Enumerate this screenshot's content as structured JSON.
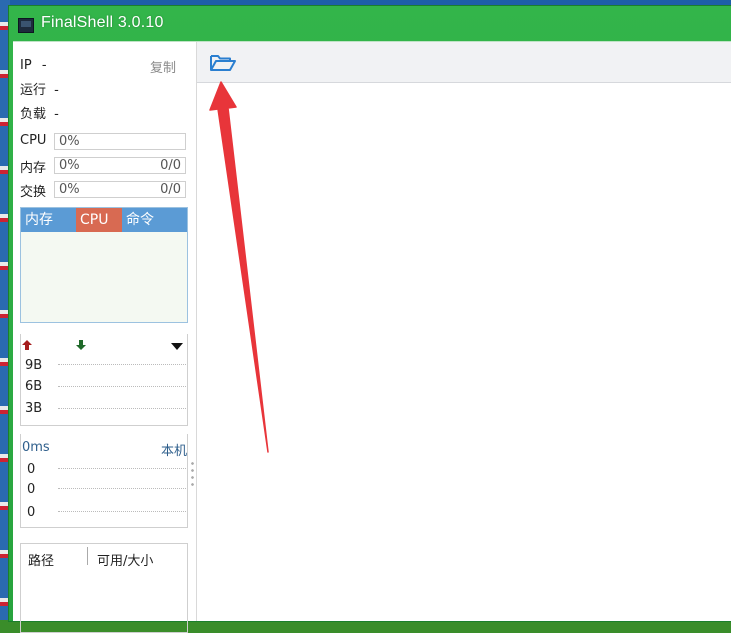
{
  "window": {
    "title": "FinalShell 3.0.10"
  },
  "sysinfo": {
    "ip_label": "IP",
    "ip_value": "-",
    "copy_label": "复制",
    "uptime_label": "运行",
    "uptime_value": "-",
    "load_label": "负载",
    "load_value": "-"
  },
  "meters": {
    "cpu": {
      "label": "CPU",
      "percent": "0%"
    },
    "memory": {
      "label": "内存",
      "percent": "0%",
      "ratio": "0/0"
    },
    "swap": {
      "label": "交换",
      "percent": "0%",
      "ratio": "0/0"
    }
  },
  "process_tabs": [
    "内存",
    "CPU",
    "命令"
  ],
  "network": {
    "up_icon": "arrow-up-icon",
    "down_icon": "arrow-down-icon",
    "y_ticks": [
      "9B",
      "6B",
      "3B"
    ]
  },
  "ping": {
    "latency": "0ms",
    "host": "本机",
    "values": [
      "0",
      "0",
      "0"
    ]
  },
  "disk": {
    "col_path": "路径",
    "col_size": "可用/大小"
  },
  "toolbar": {
    "open_icon": "folder-open-icon"
  },
  "colors": {
    "titlebar": "#2fb045",
    "tab_header": "#5b9bd5",
    "tab_cpu": "#d86a52",
    "annotation_arrow": "#e8353a",
    "folder_icon": "#2b7fd0"
  }
}
